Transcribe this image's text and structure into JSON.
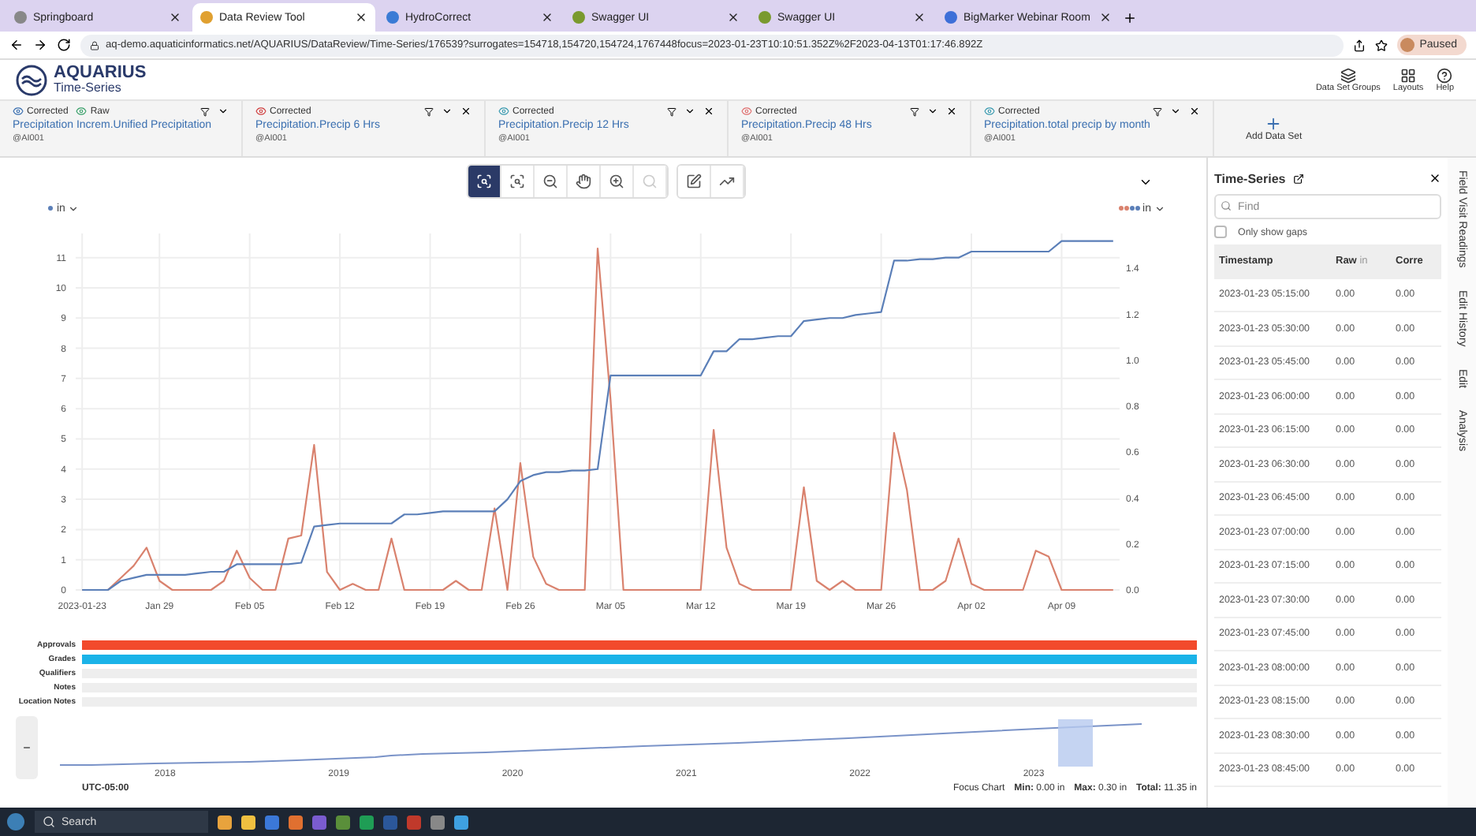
{
  "browser": {
    "tabs": [
      {
        "title": "Springboard",
        "selected": false
      },
      {
        "title": "Data Review Tool",
        "selected": true
      },
      {
        "title": "HydroCorrect",
        "selected": false
      },
      {
        "title": "Swagger UI",
        "selected": false
      },
      {
        "title": "Swagger UI",
        "selected": false
      },
      {
        "title": "BigMarker Webinar Room",
        "selected": false
      }
    ],
    "url": "aq-demo.aquaticinformatics.net/AQUARIUS/DataReview/Time-Series/176539?surrogates=154718,154720,154724,1767448focus=2023-01-23T10:10:51.352Z%2F2023-04-13T01:17:46.892Z",
    "profile": "Paused"
  },
  "app": {
    "logo_title": "AQUARIUS",
    "logo_subtitle": "Time-Series",
    "actions": [
      {
        "label": "Data Set Groups",
        "kind": "groups"
      },
      {
        "label": "Layouts",
        "kind": "layouts"
      },
      {
        "label": "Help",
        "kind": "help"
      }
    ]
  },
  "datasets": [
    {
      "badges": [
        {
          "label": "Corrected",
          "kind": "corrected"
        },
        {
          "label": "Raw",
          "kind": "raw"
        }
      ],
      "name": "Precipitation Increm.Unified Precipitation",
      "location": "@AI001"
    },
    {
      "badges": [
        {
          "label": "Corrected",
          "kind": "corrected-red"
        }
      ],
      "name": "Precipitation.Precip 6 Hrs",
      "location": "@AI001"
    },
    {
      "badges": [
        {
          "label": "Corrected",
          "kind": "corrected-teal"
        }
      ],
      "name": "Precipitation.Precip 12 Hrs",
      "location": "@AI001"
    },
    {
      "badges": [
        {
          "label": "Corrected",
          "kind": "corrected-pink"
        }
      ],
      "name": "Precipitation.Precip 48 Hrs",
      "location": "@AI001"
    },
    {
      "badges": [
        {
          "label": "Corrected",
          "kind": "corrected-teal"
        }
      ],
      "name": "Precipitation.total precip by month",
      "location": "@AI001"
    }
  ],
  "add_dataset": "Add Data Set",
  "toolbar": {
    "tools": [
      {
        "kind": "zoom-box",
        "selected": true,
        "disabled": false
      },
      {
        "kind": "zoom-area",
        "selected": false,
        "disabled": false
      },
      {
        "kind": "zoom-out",
        "selected": false,
        "disabled": false
      },
      {
        "kind": "pan",
        "selected": false,
        "disabled": false
      },
      {
        "kind": "zoom-in",
        "selected": false,
        "disabled": false
      },
      {
        "kind": "zoom-reset",
        "selected": false,
        "disabled": true
      },
      {
        "kind": "edit",
        "selected": false,
        "disabled": false
      },
      {
        "kind": "trend",
        "selected": false,
        "disabled": false
      }
    ]
  },
  "chart": {
    "left_unit": "in",
    "right_unit": "in",
    "right_yticks": [
      "1.4",
      "1.2",
      "1.0",
      "0.8",
      "0.6",
      "0.4",
      "0.2",
      "0.0"
    ],
    "chart_data": {
      "type": "line",
      "categories": [
        "2023-01-23",
        null,
        null,
        null,
        null,
        null,
        "Jan 29",
        null,
        null,
        null,
        null,
        null,
        null,
        "Feb 05",
        null,
        null,
        null,
        null,
        null,
        null,
        "Feb 12",
        null,
        null,
        null,
        null,
        null,
        null,
        "Feb 19",
        null,
        null,
        null,
        null,
        null,
        null,
        "Feb 26",
        null,
        null,
        null,
        null,
        null,
        null,
        "Mar 05",
        null,
        null,
        null,
        null,
        null,
        null,
        "Mar 12",
        null,
        null,
        null,
        null,
        null,
        null,
        "Mar 19",
        null,
        null,
        null,
        null,
        null,
        null,
        "Mar 26",
        null,
        null,
        null,
        null,
        null,
        null,
        "Apr 02",
        null,
        null,
        null,
        null,
        null,
        null,
        "Apr 09",
        null,
        null,
        null,
        null
      ],
      "ylim": [
        0,
        11.8
      ],
      "grid": true,
      "yticks": [
        0,
        1,
        2,
        3,
        4,
        5,
        6,
        7,
        8,
        9,
        10,
        11
      ],
      "series": [
        {
          "color": "#d9826e",
          "values": [
            0,
            0,
            0,
            0.4,
            0.8,
            1.4,
            0.3,
            0,
            0,
            0,
            0,
            0.3,
            1.3,
            0.4,
            0,
            0,
            1.7,
            1.8,
            4.8,
            0.6,
            0,
            0.2,
            0,
            0,
            1.7,
            0,
            0,
            0,
            0,
            0.3,
            0,
            0,
            2.7,
            0,
            4.2,
            1.1,
            0.2,
            0,
            0,
            0,
            11.3,
            6.3,
            0,
            0,
            0,
            0,
            0,
            0,
            0,
            5.3,
            1.4,
            0.2,
            0,
            0,
            0,
            0,
            3.4,
            0.3,
            0,
            0.3,
            0,
            0,
            0,
            5.2,
            3.3,
            0,
            0,
            0.3,
            1.7,
            0.2,
            0,
            0,
            0,
            0,
            1.3,
            1.1,
            0,
            0,
            0,
            0,
            0
          ]
        },
        {
          "color": "#5b7fb8",
          "values": [
            0,
            0,
            0,
            0.3,
            0.4,
            0.5,
            0.5,
            0.5,
            0.5,
            0.55,
            0.6,
            0.6,
            0.85,
            0.85,
            0.85,
            0.85,
            0.85,
            0.9,
            2.1,
            2.15,
            2.2,
            2.2,
            2.2,
            2.2,
            2.2,
            2.5,
            2.5,
            2.55,
            2.6,
            2.6,
            2.6,
            2.6,
            2.6,
            3.0,
            3.6,
            3.8,
            3.9,
            3.9,
            3.95,
            3.95,
            4.0,
            7.1,
            7.1,
            7.1,
            7.1,
            7.1,
            7.1,
            7.1,
            7.1,
            7.9,
            7.9,
            8.3,
            8.3,
            8.35,
            8.4,
            8.4,
            8.9,
            8.95,
            9.0,
            9.0,
            9.1,
            9.15,
            9.2,
            10.9,
            10.9,
            10.95,
            10.95,
            11.0,
            11.0,
            11.2,
            11.2,
            11.2,
            11.2,
            11.2,
            11.2,
            11.2,
            11.55,
            11.55,
            11.55,
            11.55,
            11.55
          ]
        }
      ]
    }
  },
  "strips": [
    {
      "label": "Approvals",
      "color": "#f24a2c"
    },
    {
      "label": "Grades",
      "color": "#1ab3e8"
    },
    {
      "label": "Qualifiers",
      "color": "#eeeeee"
    },
    {
      "label": "Notes",
      "color": "#eeeeee"
    },
    {
      "label": "Location Notes",
      "color": "#eeeeee"
    }
  ],
  "overview": {
    "years": [
      "2018",
      "2019",
      "2020",
      "2021",
      "2022",
      "2023"
    ]
  },
  "footer": {
    "timezone": "UTC-05:00",
    "focus": "Focus Chart",
    "stats": [
      "**Min:** 0.00 in",
      "**Max:** 0.30 in",
      "**Total:** 11.35 in"
    ]
  },
  "panel": {
    "title": "Time-Series",
    "search": {
      "placeholder": "Find"
    },
    "gaps": {
      "label": "Only show gaps",
      "checked": false
    },
    "columns": [
      {
        "label": "Timestamp"
      },
      {
        "label": "Raw",
        "unit": "in"
      },
      {
        "label": "Corre"
      }
    ],
    "rows": [
      [
        "2023-01-23 05:15:00",
        "0.00",
        "0.00"
      ],
      [
        "2023-01-23 05:30:00",
        "0.00",
        "0.00"
      ],
      [
        "2023-01-23 05:45:00",
        "0.00",
        "0.00"
      ],
      [
        "2023-01-23 06:00:00",
        "0.00",
        "0.00"
      ],
      [
        "2023-01-23 06:15:00",
        "0.00",
        "0.00"
      ],
      [
        "2023-01-23 06:30:00",
        "0.00",
        "0.00"
      ],
      [
        "2023-01-23 06:45:00",
        "0.00",
        "0.00"
      ],
      [
        "2023-01-23 07:00:00",
        "0.00",
        "0.00"
      ],
      [
        "2023-01-23 07:15:00",
        "0.00",
        "0.00"
      ],
      [
        "2023-01-23 07:30:00",
        "0.00",
        "0.00"
      ],
      [
        "2023-01-23 07:45:00",
        "0.00",
        "0.00"
      ],
      [
        "2023-01-23 08:00:00",
        "0.00",
        "0.00"
      ],
      [
        "2023-01-23 08:15:00",
        "0.00",
        "0.00"
      ],
      [
        "2023-01-23 08:30:00",
        "0.00",
        "0.00"
      ],
      [
        "2023-01-23 08:45:00",
        "0.00",
        "0.00"
      ]
    ]
  },
  "side_tabs": [
    "Field Visit Readings",
    "Edit History",
    "Edit",
    "Analysis"
  ],
  "taskbar": {
    "search": "Search"
  }
}
